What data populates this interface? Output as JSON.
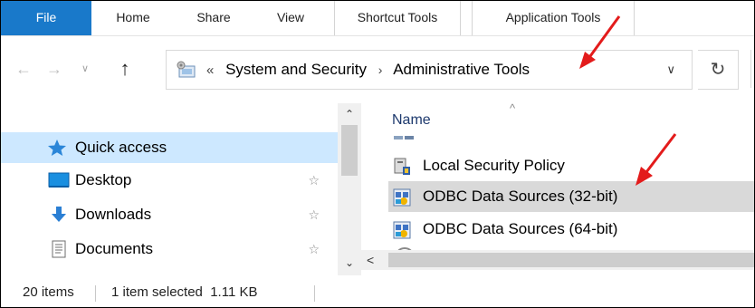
{
  "ribbon": {
    "tabs": [
      {
        "label": "File"
      },
      {
        "label": "Home"
      },
      {
        "label": "Share"
      },
      {
        "label": "View"
      },
      {
        "label": "Shortcut Tools"
      },
      {
        "label": "Application Tools"
      }
    ]
  },
  "navigation": {
    "back_icon": "left-arrow-icon",
    "forward_icon": "right-arrow-icon",
    "recent_icon": "chevron-down-icon",
    "up_icon": "up-arrow-icon",
    "address": {
      "overflow": "«",
      "crumbs": [
        "System and Security",
        "Administrative Tools"
      ],
      "separator": "›",
      "dropdown_icon": "chevron-down-icon"
    },
    "refresh_icon": "refresh-icon"
  },
  "nav_pane": {
    "items": [
      {
        "label": "Quick access",
        "icon": "star-icon",
        "selected": true
      },
      {
        "label": "Desktop",
        "icon": "desktop-icon",
        "pinned": true
      },
      {
        "label": "Downloads",
        "icon": "download-icon",
        "pinned": true
      },
      {
        "label": "Documents",
        "icon": "documents-icon",
        "pinned": true
      }
    ]
  },
  "file_list": {
    "column_header": "Name",
    "sort_indicator": "^",
    "rows": [
      {
        "name": "Local Security Policy",
        "icon": "security-policy-icon",
        "selected": false
      },
      {
        "name": "ODBC Data Sources (32-bit)",
        "icon": "odbc-icon",
        "selected": true
      },
      {
        "name": "ODBC Data Sources (64-bit)",
        "icon": "odbc-icon",
        "selected": false
      }
    ]
  },
  "status_bar": {
    "item_count": "20 items",
    "selection": "1 item selected  1.11 KB"
  },
  "colors": {
    "file_tab_bg": "#1979ca",
    "selection_bg": "#cde8ff",
    "row_selected_bg": "#d9d9d9",
    "annotation_arrow": "#e31b1b"
  }
}
